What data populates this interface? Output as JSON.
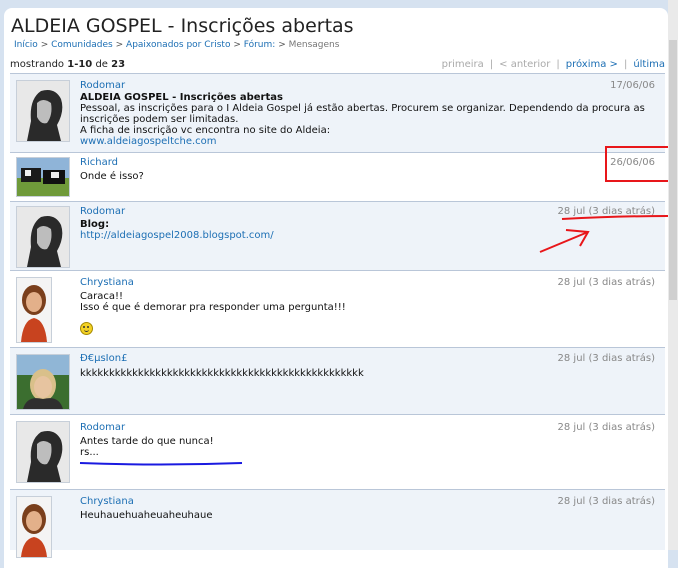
{
  "page": {
    "title": "ALDEIA GOSPEL - Inscrições abertas"
  },
  "breadcrumb": [
    {
      "label": "Início"
    },
    {
      "label": "Comunidades"
    },
    {
      "label": "Apaixonados por Cristo"
    },
    {
      "label": "Fórum:"
    },
    {
      "label": "Mensagens"
    }
  ],
  "pager": {
    "showing_prefix": "mostrando",
    "range": "1-10",
    "of_word": "de",
    "total": "23",
    "first": "primeira",
    "prev": "< anterior",
    "next": "próxima >",
    "last": "última"
  },
  "posts": [
    {
      "author": "Rodomar",
      "date": "17/06/06",
      "subject": "ALDEIA GOSPEL - Inscrições abertas",
      "lines": [
        "Pessoal, as inscrições para o I Aldeia Gospel já estão abertas. Procurem se organizar. Dependendo da procura as",
        "inscrições podem ser limitadas.",
        "A ficha de inscrição vc encontra no site do Aldeia:"
      ],
      "link": "www.aldeiagospeltche.com"
    },
    {
      "author": "Richard",
      "date": "26/06/06",
      "text": "Onde é isso?"
    },
    {
      "author": "Rodomar",
      "date": "28 jul (3 dias atrás)",
      "label": "Blog:",
      "link": "http://aldeiagospel2008.blogspot.com/"
    },
    {
      "author": "Chrystiana",
      "date": "28 jul (3 dias atrás)",
      "lines": [
        "Caraca!!",
        "Isso é que é demorar pra responder uma pergunta!!!"
      ]
    },
    {
      "author": "Ð€µsIon£",
      "date": "28 jul (3 dias atrás)",
      "text": "kkkkkkkkkkkkkkkkkkkkkkkkkkkkkkkkkkkkkkkkkkkkkkkkk"
    },
    {
      "author": "Rodomar",
      "date": "28 jul (3 dias atrás)",
      "lines": [
        "Antes tarde do que nunca!",
        "rs..."
      ]
    },
    {
      "author": "Chrystiana",
      "date": "28 jul (3 dias atrás)",
      "text": "Heuhauehuaheuaheuhaue"
    }
  ],
  "annotation_colors": {
    "red": "#e8161a",
    "blue": "#1a1ae0"
  }
}
